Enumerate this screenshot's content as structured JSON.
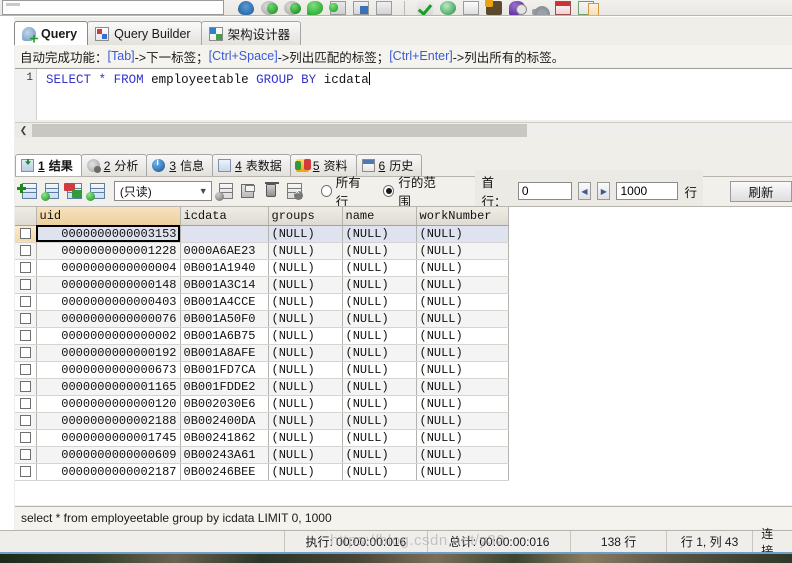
{
  "top_toolbar": {
    "combo_value": "",
    "icons": [
      "save-disk-icon",
      "globe-down-icon",
      "globe-up-icon",
      "green-bubble-icon",
      "table-green-icon",
      "table-blue-icon",
      "grid-icon",
      "check-icon",
      "refresh-globe-icon",
      "book-icon",
      "truck-icon",
      "purple-clock-icon",
      "key-icon",
      "calendar-red-icon",
      "two-tables-icon"
    ]
  },
  "query_tabs": [
    {
      "label": "Query",
      "icon": "query-icon",
      "active": true
    },
    {
      "label": "Query Builder",
      "icon": "query-builder-icon",
      "active": false
    },
    {
      "label": "架构设计器",
      "icon": "schema-designer-icon",
      "active": false
    }
  ],
  "hint": {
    "prefix": "自动完成功能：",
    "key1": "[Tab]",
    "text1": "->下一标签；",
    "key2": "[Ctrl+Space]",
    "text2": "->列出匹配的标签；",
    "key3": "[Ctrl+Enter]",
    "text3": "->列出所有的标签。"
  },
  "editor": {
    "line_number": "1",
    "kw_select": "SELECT",
    "star": "*",
    "kw_from": "FROM",
    "table": "employeetable",
    "kw_group": "GROUP",
    "kw_by": "BY",
    "column": "icdata"
  },
  "result_tabs": [
    {
      "num": "1",
      "label": "结果",
      "icon": "result-icon",
      "active": true
    },
    {
      "num": "2",
      "label": "分析",
      "icon": "profile-icon",
      "active": false
    },
    {
      "num": "3",
      "label": "信息",
      "icon": "info-icon",
      "active": false
    },
    {
      "num": "4",
      "label": "表数据",
      "icon": "table-icon",
      "active": false
    },
    {
      "num": "5",
      "label": "资料",
      "icon": "status-icon",
      "active": false
    },
    {
      "num": "6",
      "label": "历史",
      "icon": "history-icon",
      "active": false
    }
  ],
  "grid_toolbar": {
    "buttons": [
      "insert-record-icon",
      "duplicate-record-icon",
      "edit-record-icon",
      "add-record-icon",
      "apply-change-icon",
      "save-icon",
      "delete-record-icon",
      "cancel-change-icon"
    ],
    "mode_combo": "(只读)",
    "radio_all_rows": "所有行",
    "radio_row_range": "行的范围",
    "radio_selected": "row_range",
    "first_row_label": "首行：",
    "first_row_value": "0",
    "row_count_value": "1000",
    "row_unit": "行",
    "refresh_label": "刷新"
  },
  "grid": {
    "columns": [
      "uid",
      "icdata",
      "groups",
      "name",
      "workNumber"
    ],
    "selected_column": "uid",
    "focused_cell": {
      "row": 0,
      "col": 0
    },
    "rows": [
      [
        "0000000000003153",
        "",
        "(NULL)",
        "(NULL)",
        "(NULL)"
      ],
      [
        "0000000000001228",
        "0000A6AE23",
        "(NULL)",
        "(NULL)",
        "(NULL)"
      ],
      [
        "0000000000000004",
        "0B001A1940",
        "(NULL)",
        "(NULL)",
        "(NULL)"
      ],
      [
        "0000000000000148",
        "0B001A3C14",
        "(NULL)",
        "(NULL)",
        "(NULL)"
      ],
      [
        "0000000000000403",
        "0B001A4CCE",
        "(NULL)",
        "(NULL)",
        "(NULL)"
      ],
      [
        "0000000000000076",
        "0B001A50F0",
        "(NULL)",
        "(NULL)",
        "(NULL)"
      ],
      [
        "0000000000000002",
        "0B001A6B75",
        "(NULL)",
        "(NULL)",
        "(NULL)"
      ],
      [
        "0000000000000192",
        "0B001A8AFE",
        "(NULL)",
        "(NULL)",
        "(NULL)"
      ],
      [
        "0000000000000673",
        "0B001FD7CA",
        "(NULL)",
        "(NULL)",
        "(NULL)"
      ],
      [
        "0000000000001165",
        "0B001FDDE2",
        "(NULL)",
        "(NULL)",
        "(NULL)"
      ],
      [
        "0000000000000120",
        "0B002030E6",
        "(NULL)",
        "(NULL)",
        "(NULL)"
      ],
      [
        "0000000000002188",
        "0B002400DA",
        "(NULL)",
        "(NULL)",
        "(NULL)"
      ],
      [
        "0000000000001745",
        "0B00241862",
        "(NULL)",
        "(NULL)",
        "(NULL)"
      ],
      [
        "0000000000000609",
        "0B00243A61",
        "(NULL)",
        "(NULL)",
        "(NULL)"
      ],
      [
        "0000000000002187",
        "0B00246BEE",
        "(NULL)",
        "(NULL)",
        "(NULL)"
      ]
    ]
  },
  "query_echo": "select * from employeetable group by icdata  LIMIT 0, 1000",
  "status_bar": {
    "exec_time": "执行: 00:00:00:016",
    "total_time": "总计: 00:00:00:016",
    "row_count": "138 行",
    "cursor_pos": "行 1, 列 43",
    "connection": "连接"
  },
  "watermark": "https://blog.csdn.net/y32"
}
